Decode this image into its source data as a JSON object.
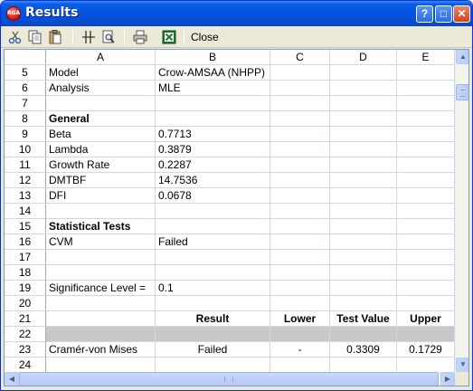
{
  "window": {
    "title": "Results",
    "app_icon_text": "RGA",
    "controls": {
      "help": "?",
      "maximize": "□",
      "close": "✕"
    }
  },
  "toolbar": {
    "icons": [
      "cut-icon",
      "copy-icon",
      "paste-icon",
      "freeze-panes-icon",
      "print-preview-icon",
      "print-icon",
      "excel-icon"
    ],
    "close_label": "Close"
  },
  "columns": [
    "A",
    "B",
    "C",
    "D",
    "E"
  ],
  "rows": [
    {
      "num": "5",
      "a": "Model",
      "b": "Crow-AMSAA (NHPP)",
      "c": "",
      "d": "",
      "e": ""
    },
    {
      "num": "6",
      "a": "Analysis",
      "b": "MLE",
      "c": "",
      "d": "",
      "e": ""
    },
    {
      "num": "7",
      "a": "",
      "b": "",
      "c": "",
      "d": "",
      "e": ""
    },
    {
      "num": "8",
      "a": "General",
      "b": "",
      "c": "",
      "d": "",
      "e": ""
    },
    {
      "num": "9",
      "a": "Beta",
      "b": "0.7713",
      "c": "",
      "d": "",
      "e": ""
    },
    {
      "num": "10",
      "a": "Lambda",
      "b": "0.3879",
      "c": "",
      "d": "",
      "e": ""
    },
    {
      "num": "11",
      "a": "Growth Rate",
      "b": "0.2287",
      "c": "",
      "d": "",
      "e": ""
    },
    {
      "num": "12",
      "a": "DMTBF",
      "b": "14.7536",
      "c": "",
      "d": "",
      "e": ""
    },
    {
      "num": "13",
      "a": "DFI",
      "b": "0.0678",
      "c": "",
      "d": "",
      "e": ""
    },
    {
      "num": "14",
      "a": "",
      "b": "",
      "c": "",
      "d": "",
      "e": ""
    },
    {
      "num": "15",
      "a": "Statistical Tests",
      "b": "",
      "c": "",
      "d": "",
      "e": ""
    },
    {
      "num": "16",
      "a": "CVM",
      "b": "Failed",
      "c": "",
      "d": "",
      "e": ""
    },
    {
      "num": "17",
      "a": "",
      "b": "",
      "c": "",
      "d": "",
      "e": ""
    },
    {
      "num": "18",
      "a": "",
      "b": "",
      "c": "",
      "d": "",
      "e": ""
    },
    {
      "num": "19",
      "a": "Significance Level =",
      "b": "0.1",
      "c": "",
      "d": "",
      "e": ""
    },
    {
      "num": "20",
      "a": "",
      "b": "",
      "c": "",
      "d": "",
      "e": ""
    },
    {
      "num": "21",
      "a": "",
      "b": "Result",
      "c": "Lower",
      "d": "Test Value",
      "e": "Upper"
    },
    {
      "num": "22",
      "a": "",
      "b": "",
      "c": "",
      "d": "",
      "e": ""
    },
    {
      "num": "23",
      "a": "Cramér-von Mises",
      "b": "Failed",
      "c": "-",
      "d": "0.3309",
      "e": "0.1729"
    },
    {
      "num": "24",
      "a": "",
      "b": "",
      "c": "",
      "d": "",
      "e": ""
    }
  ],
  "scrollbars": {
    "up": "▲",
    "down": "▼",
    "left": "◀",
    "right": "▶"
  }
}
